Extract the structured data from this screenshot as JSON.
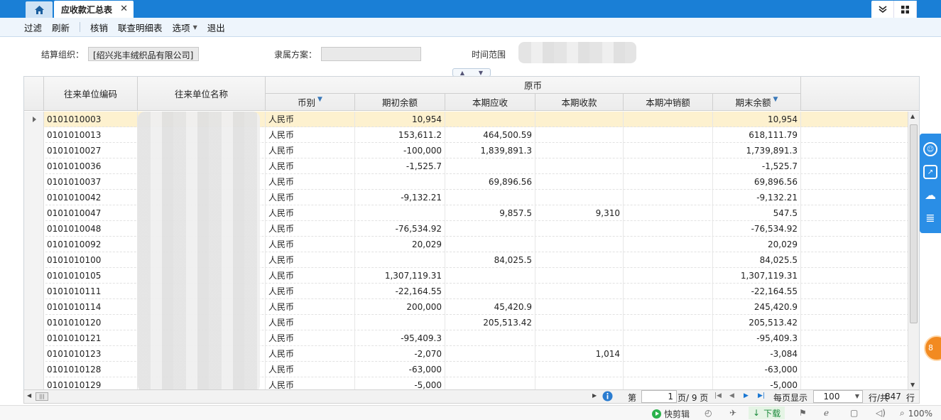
{
  "tabs": {
    "active_label": "应收款汇总表"
  },
  "toolbar": {
    "filter": "过滤",
    "refresh": "刷新",
    "writeoff": "核销",
    "detail": "联查明细表",
    "options": "选项",
    "exit": "退出"
  },
  "filters": {
    "org_label": "结算组织：",
    "org_value": "[绍兴兆丰绒织品有限公司]",
    "scheme_label": "隶属方案：",
    "scheme_value": "",
    "time_label": "时间范围"
  },
  "grid": {
    "col_code": "往来单位编码",
    "col_name": "往来单位名称",
    "group_original": "原币",
    "col_currency": "币别",
    "col_opening": "期初余额",
    "col_receivable": "本期应收",
    "col_received": "本期收款",
    "col_offset": "本期冲销额",
    "col_closing": "期末余额",
    "rows": [
      {
        "code": "0101010003",
        "name": "",
        "currency": "人民币",
        "opening": "10,954",
        "receivable": "",
        "received": "",
        "offset": "",
        "closing": "10,954"
      },
      {
        "code": "0101010013",
        "name": "",
        "currency": "人民币",
        "opening": "153,611.2",
        "receivable": "464,500.59",
        "received": "",
        "offset": "",
        "closing": "618,111.79"
      },
      {
        "code": "0101010027",
        "name": "",
        "currency": "人民币",
        "opening": "-100,000",
        "receivable": "1,839,891.3",
        "received": "",
        "offset": "",
        "closing": "1,739,891.3"
      },
      {
        "code": "0101010036",
        "name": "",
        "currency": "人民币",
        "opening": "-1,525.7",
        "receivable": "",
        "received": "",
        "offset": "",
        "closing": "-1,525.7"
      },
      {
        "code": "0101010037",
        "name": "",
        "currency": "人民币",
        "opening": "",
        "receivable": "69,896.56",
        "received": "",
        "offset": "",
        "closing": "69,896.56"
      },
      {
        "code": "0101010042",
        "name": "",
        "currency": "人民币",
        "opening": "-9,132.21",
        "receivable": "",
        "received": "",
        "offset": "",
        "closing": "-9,132.21"
      },
      {
        "code": "0101010047",
        "name": "",
        "currency": "人民币",
        "opening": "",
        "receivable": "9,857.5",
        "received": "9,310",
        "offset": "",
        "closing": "547.5"
      },
      {
        "code": "0101010048",
        "name": "",
        "currency": "人民币",
        "opening": "-76,534.92",
        "receivable": "",
        "received": "",
        "offset": "",
        "closing": "-76,534.92"
      },
      {
        "code": "0101010092",
        "name": "",
        "currency": "人民币",
        "opening": "20,029",
        "receivable": "",
        "received": "",
        "offset": "",
        "closing": "20,029"
      },
      {
        "code": "0101010100",
        "name": "",
        "currency": "人民币",
        "opening": "",
        "receivable": "84,025.5",
        "received": "",
        "offset": "",
        "closing": "84,025.5"
      },
      {
        "code": "0101010105",
        "name": "",
        "currency": "人民币",
        "opening": "1,307,119.31",
        "receivable": "",
        "received": "",
        "offset": "",
        "closing": "1,307,119.31"
      },
      {
        "code": "0101010111",
        "name": "",
        "currency": "人民币",
        "opening": "-22,164.55",
        "receivable": "",
        "received": "",
        "offset": "",
        "closing": "-22,164.55"
      },
      {
        "code": "0101010114",
        "name": "",
        "currency": "人民币",
        "opening": "200,000",
        "receivable": "45,420.9",
        "received": "",
        "offset": "",
        "closing": "245,420.9"
      },
      {
        "code": "0101010120",
        "name": "",
        "currency": "人民币",
        "opening": "",
        "receivable": "205,513.42",
        "received": "",
        "offset": "",
        "closing": "205,513.42"
      },
      {
        "code": "0101010121",
        "name": "",
        "currency": "人民币",
        "opening": "-95,409.3",
        "receivable": "",
        "received": "",
        "offset": "",
        "closing": "-95,409.3"
      },
      {
        "code": "0101010123",
        "name": "",
        "currency": "人民币",
        "opening": "-2,070",
        "receivable": "",
        "received": "1,014",
        "offset": "",
        "closing": "-3,084"
      },
      {
        "code": "0101010128",
        "name": "",
        "currency": "人民币",
        "opening": "-63,000",
        "receivable": "",
        "received": "",
        "offset": "",
        "closing": "-63,000"
      },
      {
        "code": "0101010129",
        "name": "",
        "currency": "人民币",
        "opening": "-5,000",
        "receivable": "",
        "received": "",
        "offset": "",
        "closing": "-5,000"
      }
    ]
  },
  "pager": {
    "page_prefix": "第",
    "page_current": "1",
    "page_total": "页/ 9 页",
    "per_page_label": "每页显示",
    "per_page_value": "100",
    "total_label": "行/共",
    "total_count": "847",
    "total_suffix": "行"
  },
  "status": {
    "quick_clip": "快剪辑",
    "download": "下载",
    "zoom": "100%"
  },
  "floating": {
    "orange_badge": "8"
  },
  "colors": {
    "topbar": "#1a7fd6",
    "selected_row": "#fdf1cf",
    "float_panel": "#2a8ee6",
    "accent_orange": "#f28a21"
  }
}
